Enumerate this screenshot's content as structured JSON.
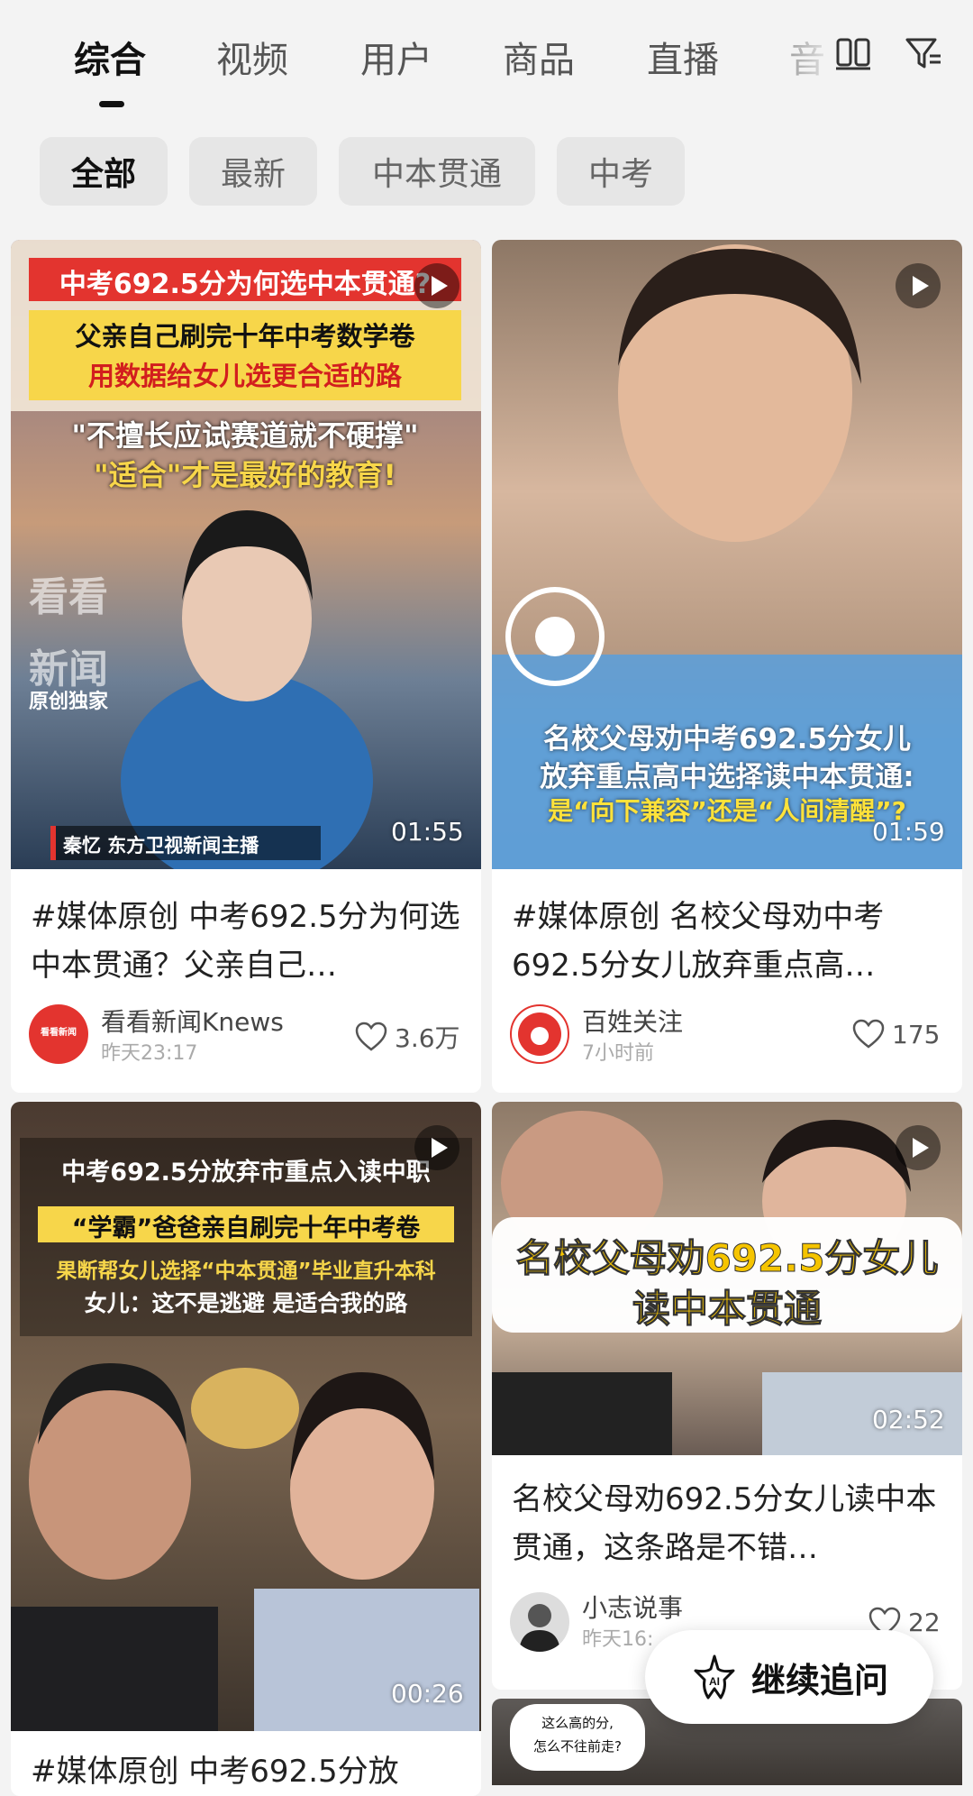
{
  "tabs": [
    "综合",
    "视频",
    "用户",
    "商品",
    "直播",
    "音"
  ],
  "chips": [
    "全部",
    "最新",
    "中本贯通",
    "中考"
  ],
  "cards": [
    {
      "overlay": {
        "line1": "中考692.5分为何选中本贯通?",
        "line2": "父亲自己刷完十年中考数学卷",
        "line3": "用数据给女儿选更合适的路",
        "line4": "\"不擅长应试赛道就不硬撑\"",
        "line5": "\"适合\"才是最好的教育!",
        "watermark1": "看看",
        "watermark2": "新闻",
        "watermark3": "原创独家",
        "caption": "秦忆 东方卫视新闻主播"
      },
      "duration": "01:55",
      "title": "#媒体原创 中考692.5分为何选中本贯通？父亲自己…",
      "author": "看看新闻Knews",
      "avatar_text": "看看新闻",
      "time": "昨天23:17",
      "likes": "3.6万"
    },
    {
      "overlay": {
        "line1": "名校父母劝中考692.5分女儿",
        "line2": "放弃重点高中选择读中本贯通:",
        "line3": "是“向下兼容”还是“人间清醒”?"
      },
      "duration": "01:59",
      "title": "#媒体原创 名校父母劝中考692.5分女儿放弃重点高…",
      "author": "百姓关注",
      "time": "7小时前",
      "likes": "175"
    },
    {
      "overlay": {
        "line1": "中考692.5分放弃市重点入读中职",
        "line2": "“学霸”爸爸亲自刷完十年中考卷",
        "line3": "果断帮女儿选择“中本贯通”毕业直升本科",
        "line4": "女儿：这不是逃避 是适合我的路"
      },
      "duration": "00:26",
      "title": "#媒体原创 中考692.5分放"
    },
    {
      "overlay": {
        "line1": "名校父母劝692.5分女儿",
        "line2": "读中本贯通"
      },
      "duration": "02:52",
      "title": "名校父母劝692.5分女儿读中本贯通，这条路是不错…",
      "author": "小志说事",
      "time": "昨天16:",
      "likes": "22"
    },
    {
      "overlay": {
        "bubble1": "这么高的分,",
        "bubble2": "怎么不往前走?"
      }
    }
  ],
  "float_button": {
    "label": "继续追问",
    "icon_text": "AI"
  },
  "colors": {
    "accent_red": "#e3342f",
    "yellow_band": "#f7d64a"
  }
}
